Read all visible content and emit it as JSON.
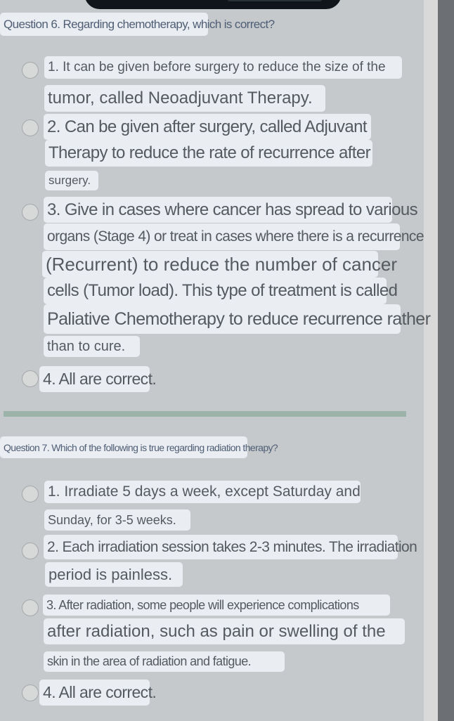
{
  "question6": {
    "title": "Question 6. Regarding chemotherapy, which is correct?",
    "options": [
      {
        "lines": [
          "1. It can be given before surgery to reduce the size of the",
          "tumor, called Neoadjuvant Therapy."
        ]
      },
      {
        "lines": [
          "2. Can be given after surgery, called Adjuvant",
          "Therapy to reduce the rate of recurrence after",
          "surgery."
        ]
      },
      {
        "lines": [
          "3. Give in cases where cancer has spread to various",
          "organs (Stage 4) or treat in cases where there is a recurrence",
          "(Recurrent) to reduce the number of cancer",
          "cells (Tumor load). This type of treatment is called",
          "Paliative Chemotherapy to reduce recurrence rather",
          "than to cure."
        ]
      },
      {
        "lines": [
          "4. All are correct."
        ]
      }
    ]
  },
  "question7": {
    "title": "Question 7. Which of the following is true regarding radiation therapy?",
    "options": [
      {
        "lines": [
          "1. Irradiate 5 days a week, except Saturday and",
          "Sunday, for 3-5 weeks."
        ]
      },
      {
        "lines": [
          "2. Each irradiation session takes 2-3 minutes. The irradiation",
          "period is painless."
        ]
      },
      {
        "lines": [
          "3. After radiation, some people will experience complications",
          "after radiation, such as pain or swelling of the",
          "skin in the area of radiation and fatigue."
        ]
      },
      {
        "lines": [
          "4. All are correct."
        ]
      }
    ]
  }
}
